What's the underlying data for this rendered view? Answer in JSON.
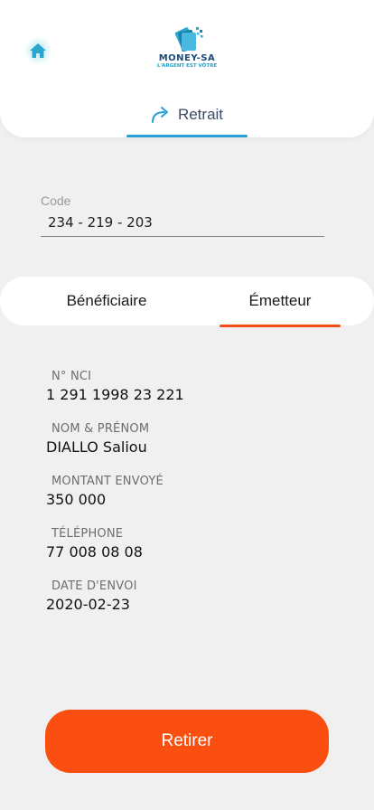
{
  "header": {
    "logo": {
      "name": "MONEY-SA",
      "tagline": "L'ARGENT EST VÔTRE"
    },
    "home_icon": "home-icon",
    "active_tab": {
      "icon": "share-arrow-icon",
      "label": "Retrait"
    }
  },
  "code": {
    "label": "Code",
    "value": "234 - 219 - 203"
  },
  "tabs": {
    "beneficiaire": "Bénéficiaire",
    "emetteur": "Émetteur",
    "active": "emetteur"
  },
  "details": [
    {
      "label": "N° NCI",
      "value": "1 291 1998 23 221"
    },
    {
      "label": "NOM & PRÉNOM",
      "value": "DIALLO Saliou"
    },
    {
      "label": "MONTANT ENVOYÉ",
      "value": "350 000"
    },
    {
      "label": "TÉLÉPHONE",
      "value": "77 008 08 08"
    },
    {
      "label": "DATE D'ENVOI",
      "value": "2020-02-23"
    }
  ],
  "action": {
    "label": "Retirer"
  },
  "colors": {
    "accent_blue": "#2a9fd8",
    "accent_orange": "#fa4f10",
    "background": "#f0f0f0"
  }
}
